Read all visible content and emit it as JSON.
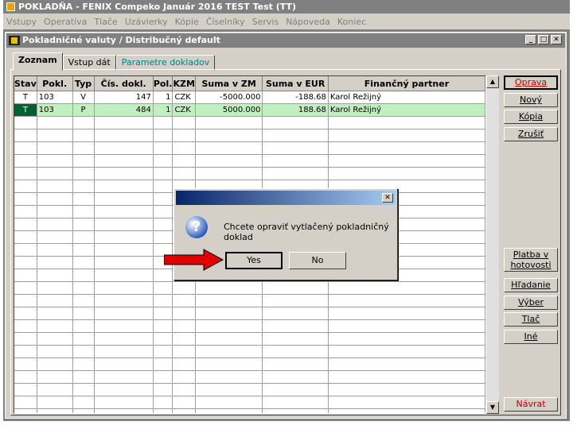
{
  "app": {
    "title": "POKLADŇA - FENIX Compeko  Január 2016  TEST Test  (TT)"
  },
  "menu": [
    "Vstupy",
    "Operatíva",
    "Tlače",
    "Uzávierky",
    "Kópie",
    "Číselníky",
    "Servis",
    "Nápoveda",
    "Koniec"
  ],
  "window": {
    "title": "Pokladničné valuty / Distribučný default"
  },
  "tabs": [
    "Zoznam",
    "Vstup dát",
    "Parametre dokladov"
  ],
  "table": {
    "columns": [
      "Stav",
      "Pokl.",
      "Typ",
      "Čís. dokl.",
      "Pol.",
      "KZM",
      "Suma v ZM",
      "Suma v EUR",
      "Finančný partner"
    ],
    "rows": [
      [
        "T",
        "103",
        "V",
        "147",
        "1",
        "CZK",
        "-5000.000",
        "-188.68",
        "Karol Režijný"
      ],
      [
        "T",
        "103",
        "P",
        "484",
        "1",
        "CZK",
        "5000.000",
        "188.68",
        "Karol Režijný"
      ]
    ]
  },
  "buttons": {
    "oprava": "Oprava",
    "novy": "Nový",
    "kopia": "Kópia",
    "zrusit": "Zrušiť",
    "platba": "Platba v hotovosti",
    "hladanie": "Hľadanie",
    "vyber": "Výber",
    "tlac": "Tlač",
    "ine": "Iné",
    "navrat": "Návrat"
  },
  "dialog": {
    "message": "Chcete opraviť vytlačený pokladničný doklad",
    "yes": "Yes",
    "no": "No"
  },
  "colors": {
    "selected_row": "#c0f0c0",
    "status_cell": "#006030",
    "arrow": "#e00000"
  }
}
